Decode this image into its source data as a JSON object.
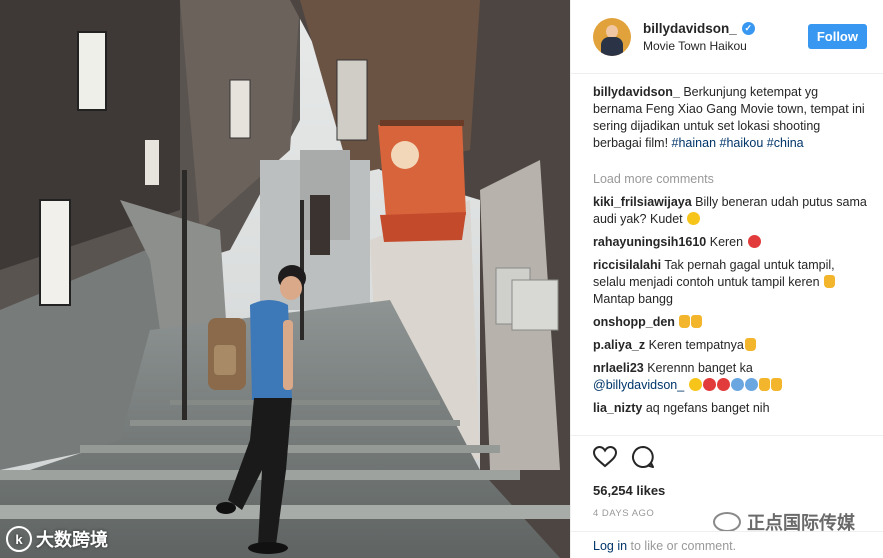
{
  "post": {
    "username": "billydavidson_",
    "location": "Movie Town Haikou",
    "follow_label": "Follow",
    "caption": {
      "user": "billydavidson_",
      "text": "Berkunjung ketempat yg bernama Feng Xiao Gang Movie town, tempat ini sering dijadikan untuk set lokasi shooting berbagai film!",
      "tags": [
        "#hainan",
        "#haikou",
        "#china"
      ]
    },
    "load_more": "Load more comments",
    "comments": [
      {
        "user": "kiki_frilsiawijaya",
        "text": "Billy beneran udah putus sama audi yak? Kudet",
        "emoji": [
          "grin"
        ]
      },
      {
        "user": "rahayuningsih1610",
        "text": "Keren",
        "emoji": [
          "heart-eyes"
        ]
      },
      {
        "user": "riccisilalahi",
        "text": "Tak pernah gagal untuk tampil, selalu menjadi contoh untuk tampil keren",
        "text2": "Mantap bangg",
        "emoji": [
          "ok-hand"
        ]
      },
      {
        "user": "onshopp_den",
        "text": "",
        "emoji": [
          "thumbs-up",
          "thumbs-up"
        ]
      },
      {
        "user": "p.aliya_z",
        "text": "Keren tempatnya",
        "emoji": [
          "thumbs-up"
        ]
      },
      {
        "user": "nrlaeli23",
        "text": "Kerennn banget ka",
        "mention": "@billydavidson_",
        "emoji": [
          "grin",
          "heart-eyes",
          "heart-eyes",
          "pray",
          "pray",
          "thumbs-up",
          "thumbs-up"
        ]
      },
      {
        "user": "lia_nizty",
        "text": "aq ngefans banget nih",
        "emoji": []
      }
    ],
    "likes": "56,254 likes",
    "time": "4 DAYS AGO",
    "login_link": "Log in",
    "login_text": " to like or comment."
  },
  "watermarks": {
    "left_logo": "k",
    "left_text": "大数跨境",
    "right_text": "正点国际传媒"
  },
  "icons": {
    "like": "heart-outline-icon",
    "comment": "comment-bubble-icon",
    "verified": "verified-badge-icon"
  },
  "colors": {
    "accent": "#3897f0",
    "link": "#003569",
    "muted": "#999999"
  }
}
